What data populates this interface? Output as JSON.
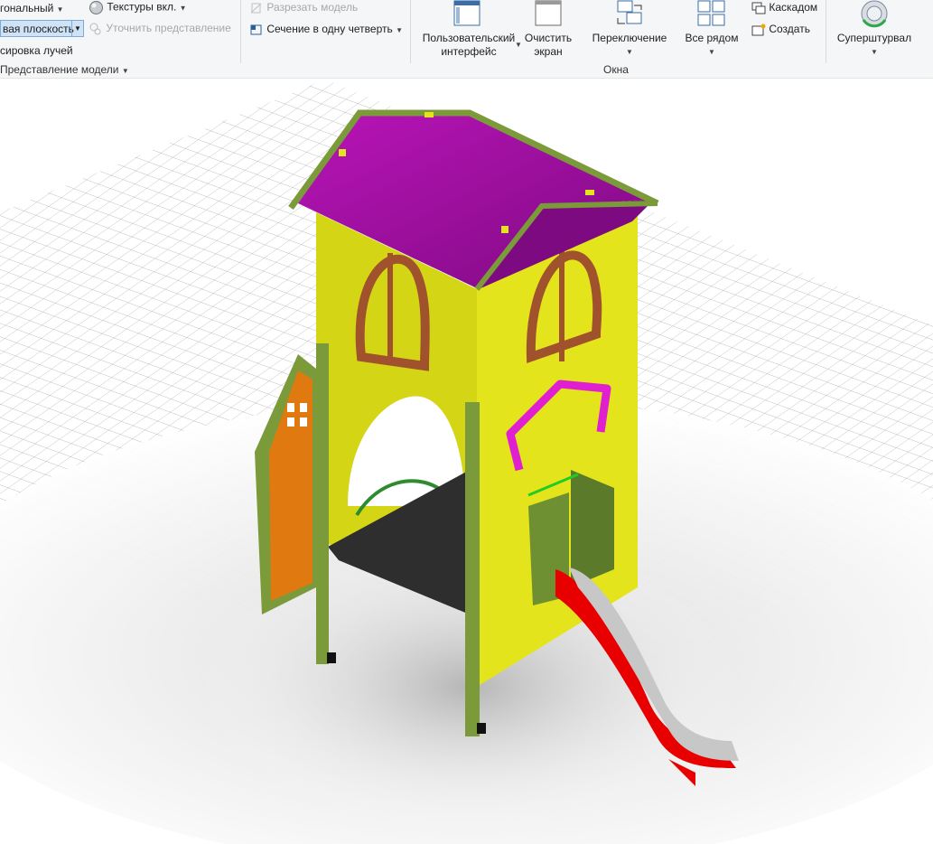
{
  "ribbon": {
    "left_group": {
      "style_label": "гональный",
      "textures_label": "Текстуры вкл.",
      "plane_value": "вая плоскость",
      "refine_label": "Уточнить представление",
      "raytrace_label": "сировка лучей",
      "group_label": "Представление модели"
    },
    "section_group": {
      "cut_label": "Разрезать модель",
      "quarter_label": "Сечение в одну четверть"
    },
    "windows_group": {
      "ui_label_line1": "Пользовательский",
      "ui_label_line2": "интерфейс",
      "clear_label_line1": "Очистить",
      "clear_label_line2": "экран",
      "switch_label": "Переключение",
      "tile_label": "Все рядом",
      "cascade_label": "Каскадом",
      "new_label": "Создать",
      "group_label": "Окна"
    },
    "nav_group": {
      "wheel_label": "Суперштурвал"
    }
  },
  "viewport": {
    "model_colors": {
      "roof": "#a10aa3",
      "walls": "#dfe21a",
      "trim": "#7b9a3a",
      "windows": "#a0522d",
      "door": "#e07a10",
      "slide": "#e80000",
      "floor": "#2e2e2e",
      "handle": "#e020d0"
    }
  }
}
